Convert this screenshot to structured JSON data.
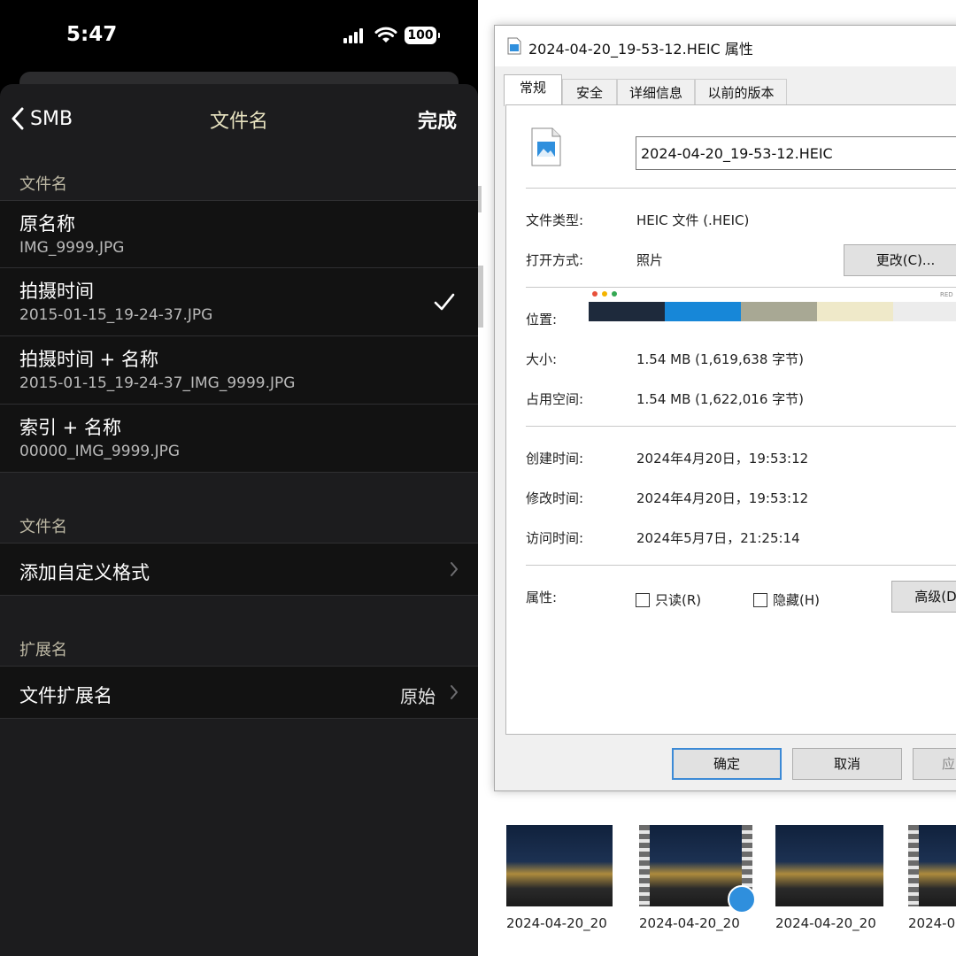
{
  "phone": {
    "status": {
      "time": "5:47",
      "battery": "100"
    },
    "nav": {
      "back_label": "SMB",
      "title": "文件名",
      "done": "完成"
    },
    "section1": {
      "header": "文件名",
      "rows": [
        {
          "title": "原名称",
          "subtitle": "IMG_9999.JPG",
          "checked": false
        },
        {
          "title": "拍摄时间",
          "subtitle": "2015-01-15_19-24-37.JPG",
          "checked": true
        },
        {
          "title": "拍摄时间 + 名称",
          "subtitle": "2015-01-15_19-24-37_IMG_9999.JPG",
          "checked": false
        },
        {
          "title": "索引 + 名称",
          "subtitle": "00000_IMG_9999.JPG",
          "checked": false
        }
      ]
    },
    "section2": {
      "header": "文件名",
      "row_title": "添加自定义格式"
    },
    "section3": {
      "header": "扩展名",
      "row_title": "文件扩展名",
      "row_value": "原始"
    }
  },
  "dialog": {
    "title": "2024-04-20_19-53-12.HEIC 属性",
    "tabs": [
      "常规",
      "安全",
      "详细信息",
      "以前的版本"
    ],
    "active_tab": "常规",
    "filename": "2024-04-20_19-53-12.HEIC",
    "file_type_label": "文件类型:",
    "file_type": "HEIC 文件 (.HEIC)",
    "open_with_label": "打开方式:",
    "open_with": "照片",
    "change_button": "更改(C)...",
    "location_label": "位置:",
    "location_colors": [
      "#1e2a3c",
      "#1787d8",
      "#a8a894",
      "#efe9c9",
      "#ececec"
    ],
    "location_text": "RED",
    "size_label": "大小:",
    "size": "1.54 MB (1,619,638 字节)",
    "disk_label": "占用空间:",
    "disk": "1.54 MB (1,622,016 字节)",
    "created_label": "创建时间:",
    "created": "2024年4月20日，19:53:12",
    "modified_label": "修改时间:",
    "modified": "2024年4月20日，19:53:12",
    "accessed_label": "访问时间:",
    "accessed": "2024年5月7日，21:25:14",
    "attributes_label": "属性:",
    "readonly": "只读(R)",
    "hidden": "隐藏(H)",
    "advanced": "高级(D",
    "ok": "确定",
    "cancel": "取消",
    "apply": "应"
  },
  "thumbnails": [
    {
      "caption": "2024-04-20_20",
      "video": false
    },
    {
      "caption": "2024-04-20_20",
      "video": true
    },
    {
      "caption": "2024-04-20_20",
      "video": false
    },
    {
      "caption": "2024-0",
      "video": true
    }
  ]
}
